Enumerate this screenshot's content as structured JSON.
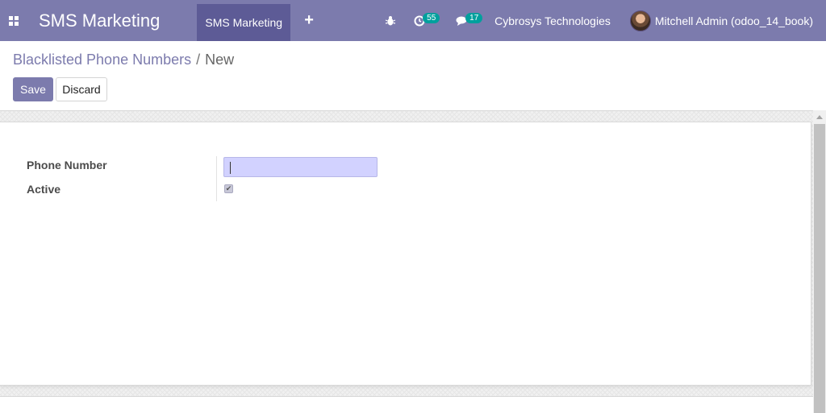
{
  "navbar": {
    "app_title": "SMS Marketing",
    "menu_active": "SMS Marketing",
    "plus_icon": "plus-icon",
    "activity_count": "55",
    "messages_count": "17",
    "company": "Cybrosys Technologies",
    "user": "Mitchell Admin (odoo_14_book)"
  },
  "breadcrumb": {
    "parent": "Blacklisted Phone Numbers",
    "separator": "/",
    "current": "New"
  },
  "buttons": {
    "save": "Save",
    "discard": "Discard"
  },
  "form": {
    "phone_label": "Phone Number",
    "phone_value": "",
    "active_label": "Active",
    "active_checked": true
  },
  "colors": {
    "brand": "#7c7bad",
    "menu_active_bg": "#5d5b96",
    "badge": "#00a09d",
    "input_highlight": "#d2d2ff"
  }
}
